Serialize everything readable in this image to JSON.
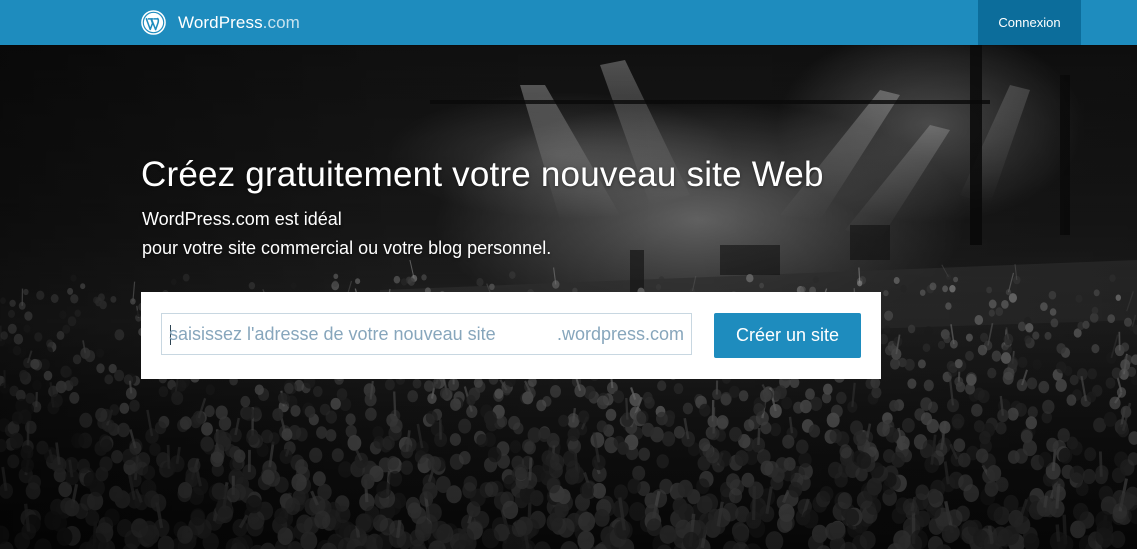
{
  "header": {
    "brand_name": "WordPress",
    "brand_suffix": ".com",
    "login_label": "Connexion",
    "brand_color": "#1e8cbe",
    "login_bg_color": "#0c6d9b"
  },
  "hero": {
    "headline": "Créez gratuitement votre nouveau site Web",
    "subline_1": "WordPress.com est idéal",
    "subline_2": "pour votre site commercial ou votre blog personnel.",
    "background_image": "concert crowd under stage lights (black and white)"
  },
  "signup": {
    "address_placeholder": "saisissez l'adresse de votre nouveau site",
    "address_value": "",
    "domain_suffix": ".wordpress.com",
    "create_label": "Créer un site",
    "button_color": "#1e8cbe"
  },
  "icons": {
    "logo": "wordpress-logo-icon"
  }
}
